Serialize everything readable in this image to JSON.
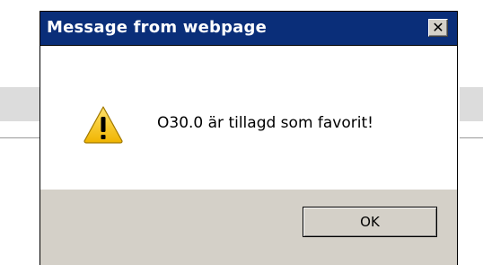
{
  "dialog": {
    "title": "Message from webpage",
    "close_glyph": "✕",
    "message": "O30.0 är tillagd som favorit!",
    "icon": "warning-icon",
    "ok_label": "OK"
  },
  "colors": {
    "titlebar": "#0a2e79",
    "footer": "#d4d0c8",
    "warning_yellow": "#f5c400"
  }
}
